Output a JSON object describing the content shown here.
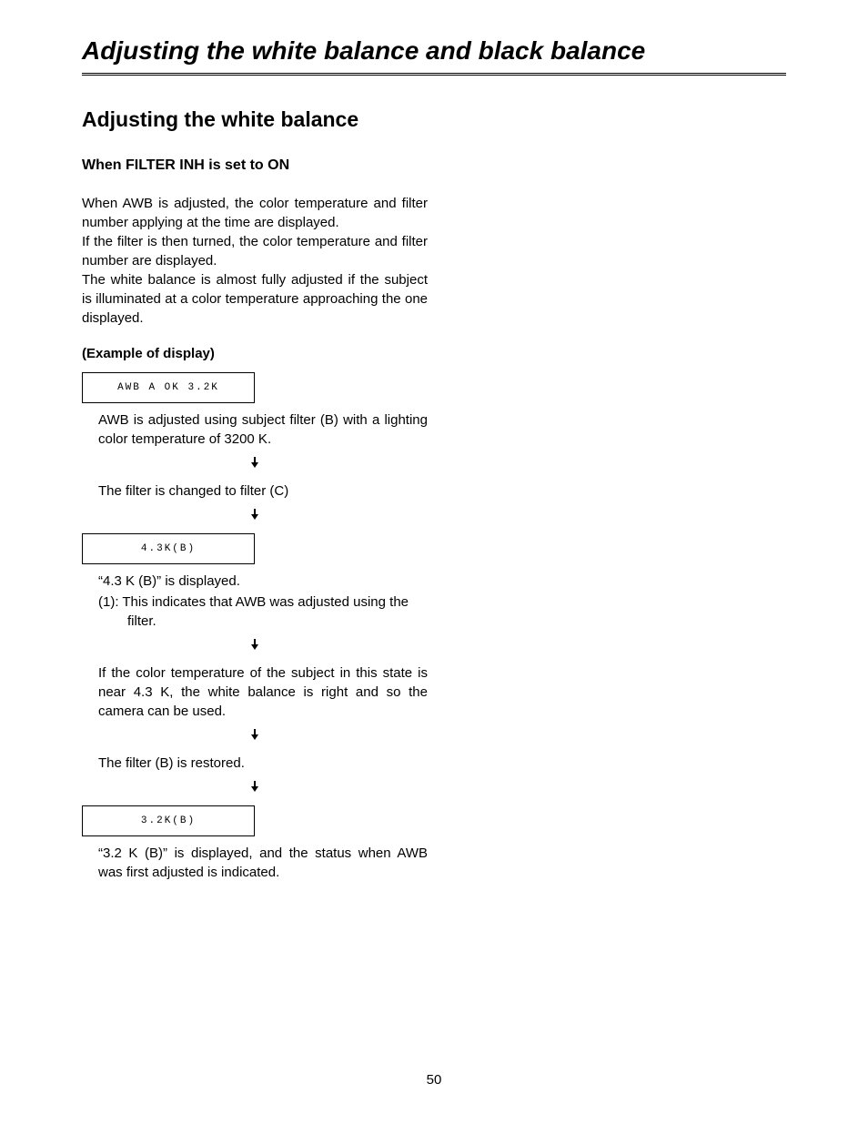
{
  "page": {
    "title": "Adjusting the white balance and black balance",
    "number": "50"
  },
  "section": {
    "title": "Adjusting the white balance"
  },
  "subsection": {
    "title": "When FILTER INH is set to ON"
  },
  "intro": {
    "p1": "When AWB is adjusted, the color temperature and filter number applying at the time are displayed.",
    "p2": "If the filter is then turned, the color temperature and filter number are displayed.",
    "p3": "The white balance is almost fully adjusted if the subject is illuminated at a color temperature approaching the one displayed."
  },
  "example": {
    "label": "(Example of display)"
  },
  "flow": {
    "box1": "AWB A OK 3.2K",
    "step1": "AWB is adjusted using subject filter (B) with a lighting color temperature of 3200 K.",
    "step2": "The filter is changed to filter (C)",
    "box2": "4.3K(B)",
    "step3a": "“4.3 K (B)” is displayed.",
    "step3b": "(1): This indicates that AWB was adjusted using the filter.",
    "step4": "If the color temperature of the subject in this state is near 4.3 K, the white balance is right and so the camera can be used.",
    "step5": "The filter (B) is restored.",
    "box3": "3.2K(B)",
    "step6": "“3.2 K (B)” is displayed, and the status when AWB was first adjusted is indicated."
  }
}
